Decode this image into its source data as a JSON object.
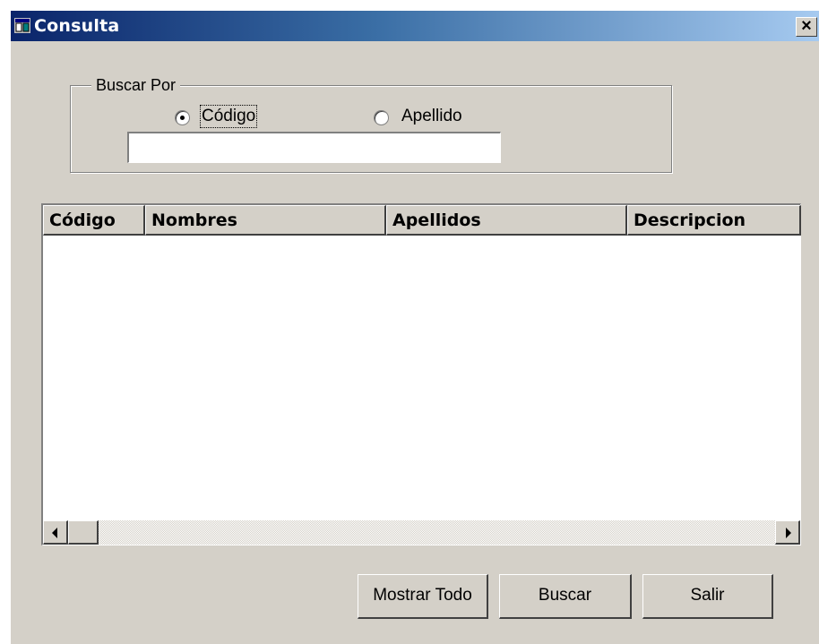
{
  "window": {
    "title": "Consulta",
    "close_label": "×"
  },
  "search": {
    "group_label": "Buscar Por",
    "options": [
      {
        "label": "Código",
        "selected": true
      },
      {
        "label": "Apellido",
        "selected": false
      }
    ],
    "input_value": ""
  },
  "grid": {
    "columns": [
      "Código",
      "Nombres",
      "Apellidos",
      "Descripcion"
    ],
    "rows": []
  },
  "buttons": {
    "show_all": "Mostrar Todo",
    "search": "Buscar",
    "exit": "Salir"
  },
  "icons": {
    "app": "app-window-icon",
    "close": "close-icon",
    "scroll_left": "scroll-left-arrow-icon",
    "scroll_right": "scroll-right-arrow-icon"
  },
  "colors": {
    "title_bar_start": "#0a246a",
    "title_bar_end": "#a6caf0",
    "face": "#d4d0c8"
  }
}
